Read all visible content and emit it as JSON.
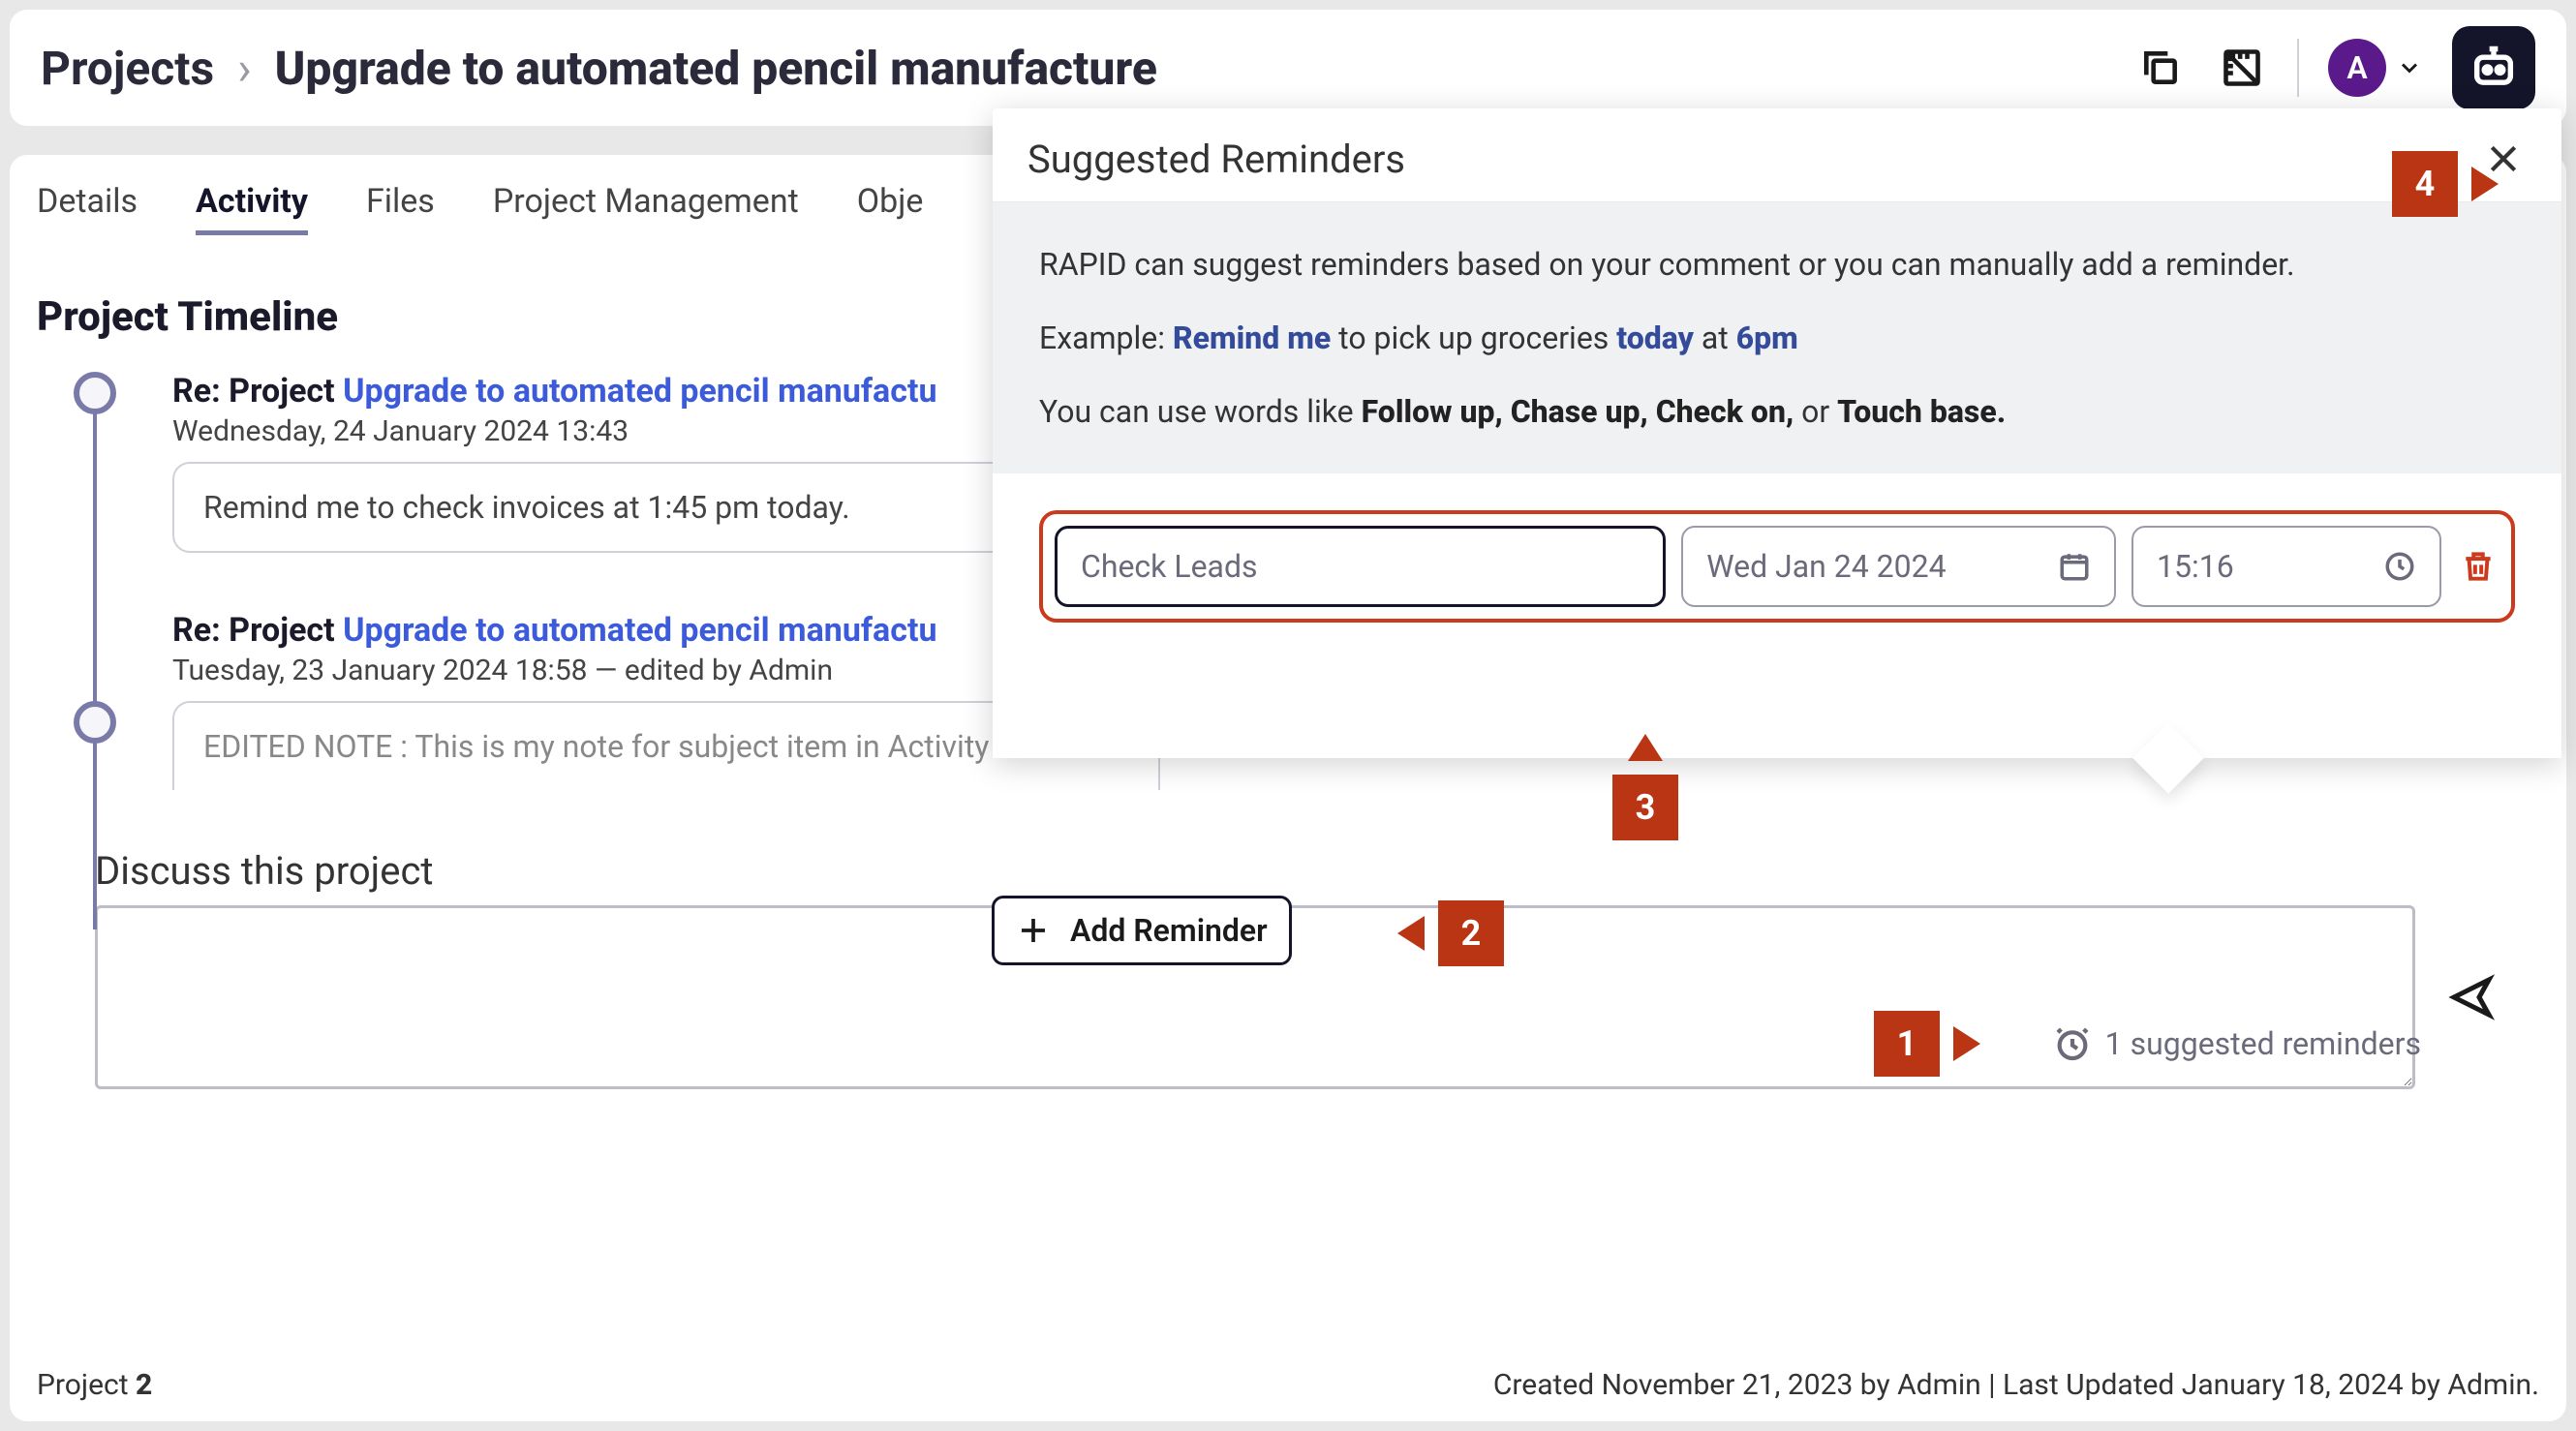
{
  "breadcrumb": {
    "root": "Projects",
    "title": "Upgrade to automated pencil manufacture"
  },
  "avatar": {
    "initial": "A"
  },
  "tabs": {
    "details": "Details",
    "activity": "Activity",
    "files": "Files",
    "pm": "Project Management",
    "obj": "Obje"
  },
  "timeline": {
    "section_title": "Project Timeline",
    "items": [
      {
        "prefix": "Re: Project ",
        "link": "Upgrade to automated pencil manufactu",
        "date": "Wednesday, 24 January 2024 13:43",
        "body": "Remind me to check invoices at 1:45 pm today."
      },
      {
        "prefix": "Re: Project ",
        "link": "Upgrade to automated pencil manufactu",
        "date": "Tuesday, 23 January 2024 18:58 — edited by Admin",
        "body": "EDITED NOTE : This is my note for subject item in Activity Feed"
      }
    ]
  },
  "discuss": {
    "title": "Discuss this project"
  },
  "suggested_link": {
    "label": "1 suggested reminders"
  },
  "popover": {
    "title": "Suggested Reminders",
    "info_line1": "RAPID can suggest reminders based on your comment or you can manually add a reminder.",
    "info_example_prefix": "Example: ",
    "info_example_remind": "Remind me",
    "info_example_mid": " to pick up groceries ",
    "info_example_today": "today",
    "info_example_at": " at ",
    "info_example_time": "6pm",
    "info_line3_prefix": "You can use words like ",
    "info_line3_bold": "Follow up, Chase up, Check on,",
    "info_line3_or": " or ",
    "info_line3_touch": "Touch base.",
    "reminder": {
      "title_value": "Check Leads",
      "date_value": "Wed Jan 24 2024",
      "time_value": "15:16"
    },
    "add_label": "Add Reminder"
  },
  "footer": {
    "left_label": "Project ",
    "left_value": "2",
    "right": "Created November 21, 2023 by Admin | Last Updated January 18, 2024 by Admin."
  },
  "callouts": {
    "1": "1",
    "2": "2",
    "3": "3",
    "4": "4"
  }
}
